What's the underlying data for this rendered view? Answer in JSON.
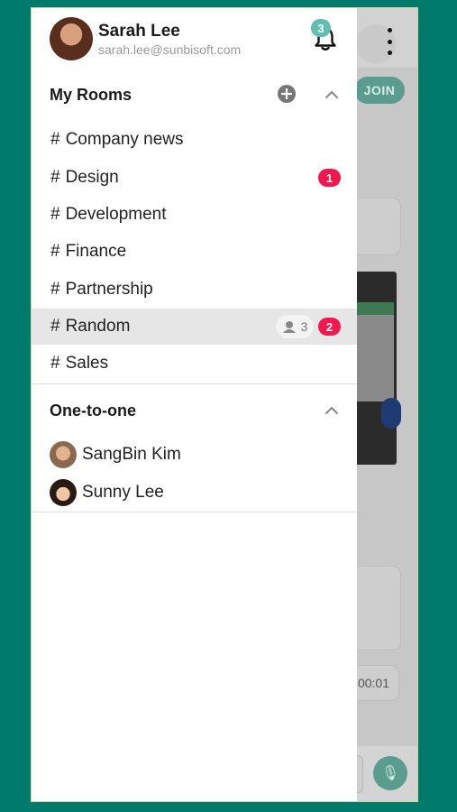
{
  "profile": {
    "name": "Sarah Lee",
    "email": "sarah.lee@sunbisoft.com",
    "notification_count": "3"
  },
  "my_rooms": {
    "title": "My Rooms",
    "rooms": [
      {
        "name": "Company news",
        "unread": ""
      },
      {
        "name": "Design",
        "unread": "1"
      },
      {
        "name": "Development",
        "unread": ""
      },
      {
        "name": "Finance",
        "unread": ""
      },
      {
        "name": "Partnership",
        "unread": ""
      },
      {
        "name": "Random",
        "unread": "2",
        "participants": "3",
        "selected": true
      },
      {
        "name": "Sales",
        "unread": ""
      }
    ]
  },
  "one_to_one": {
    "title": "One-to-one",
    "contacts": [
      {
        "name": "SangBin Kim"
      },
      {
        "name": "Sunny Lee"
      }
    ]
  },
  "background": {
    "join_label": "JOIN",
    "timer": "00:01"
  },
  "colors": {
    "accent": "#5fbfb3",
    "unread_badge": "#f2174d",
    "page_bg": "#007a6b"
  },
  "icons": [
    "bell-icon",
    "add-circle-icon",
    "chevron-up-icon",
    "more-vert-icon",
    "group-icon",
    "mic-icon"
  ]
}
